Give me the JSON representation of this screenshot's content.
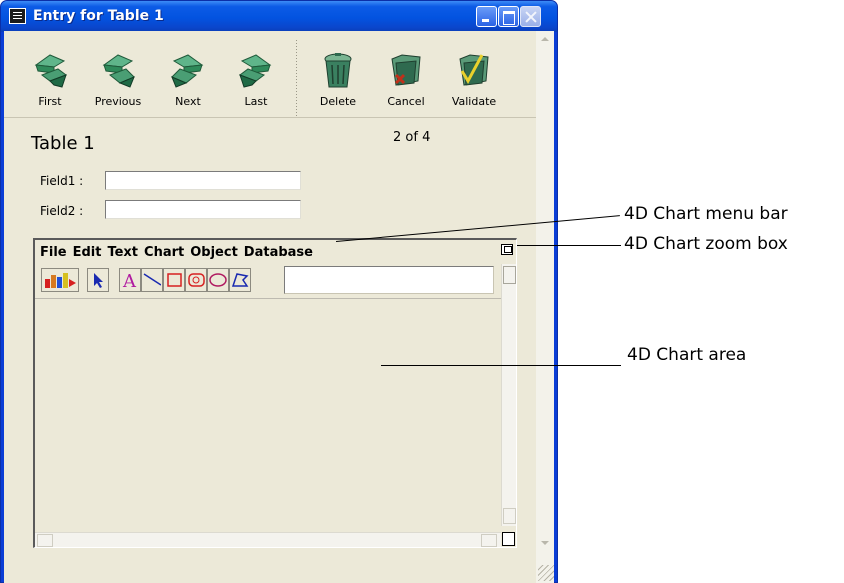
{
  "window": {
    "title": "Entry for Table 1"
  },
  "toolbar": {
    "first": "First",
    "previous": "Previous",
    "next": "Next",
    "last": "Last",
    "delete": "Delete",
    "cancel": "Cancel",
    "validate": "Validate"
  },
  "form": {
    "table_title": "Table 1",
    "record_count": "2 of 4",
    "field1_label": "Field1 :",
    "field1_value": "",
    "field2_label": "Field2 :",
    "field2_value": ""
  },
  "chart": {
    "menu": [
      "File",
      "Edit",
      "Text",
      "Chart",
      "Object",
      "Database"
    ],
    "text_field_value": ""
  },
  "callouts": {
    "menu_bar": "4D Chart menu bar",
    "zoom_box": "4D Chart zoom box",
    "chart_area": "4D Chart area"
  },
  "colors": {
    "titlebar": "#0353e0",
    "client_bg": "#ece9d8",
    "arrow_green": "#2f8a5a",
    "cancel_red": "#c0301a",
    "validate_yellow": "#e9d02c"
  },
  "icons": {
    "first": "arrow-first-icon",
    "previous": "arrow-previous-icon",
    "next": "arrow-next-icon",
    "last": "arrow-last-icon",
    "delete": "trash-can-icon",
    "cancel": "folder-cancel-icon",
    "validate": "folder-check-icon"
  }
}
